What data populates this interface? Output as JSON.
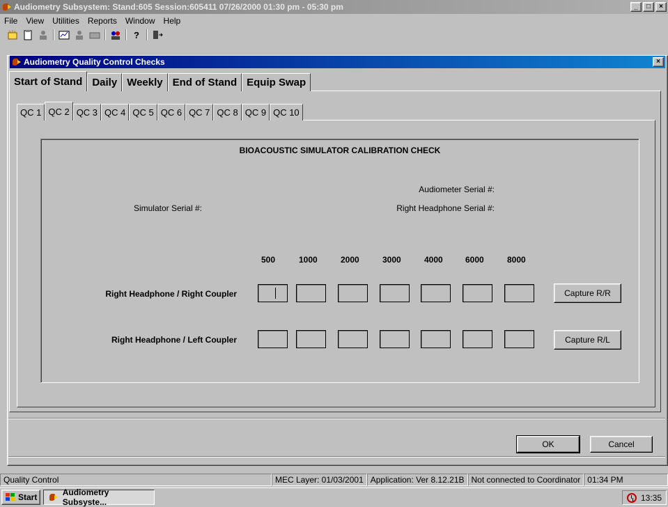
{
  "app": {
    "title": "Audiometry Subsystem: Stand:605 Session:605411 07/26/2000 01:30 pm - 05:30 pm",
    "window_buttons": [
      "_",
      "□",
      "×"
    ]
  },
  "menu": {
    "items": [
      {
        "label": "File"
      },
      {
        "label": "View"
      },
      {
        "label": "Utilities"
      },
      {
        "label": "Reports"
      },
      {
        "label": "Window"
      },
      {
        "label": "Help"
      }
    ]
  },
  "toolbar": {
    "icons": [
      "new-icon",
      "clipboard-icon",
      "person-icon",
      "chart-icon",
      "person2-icon",
      "keyboard-icon",
      "users-icon",
      "help-icon",
      "exit-icon"
    ]
  },
  "dialog": {
    "title": "Audiometry Quality Control Checks",
    "close_glyph": "×",
    "main_tabs": [
      "Start of Stand",
      "Daily",
      "Weekly",
      "End of Stand",
      "Equip Swap"
    ],
    "active_main_tab": "Start of Stand",
    "sub_tabs": [
      "QC 1",
      "QC 2",
      "QC 3",
      "QC 4",
      "QC 5",
      "QC 6",
      "QC 7",
      "QC 8",
      "QC 9",
      "QC 10"
    ],
    "active_sub_tab": "QC 2",
    "section_title": "BIOACOUSTIC SIMULATOR CALIBRATION CHECK",
    "audiometer_serial_label": "Audiometer Serial #:",
    "simulator_serial_label": "Simulator Serial #:",
    "right_headphone_serial_label": "Right Headphone Serial #:",
    "frequencies": [
      "500",
      "1000",
      "2000",
      "3000",
      "4000",
      "6000",
      "8000"
    ],
    "rows": [
      {
        "label": "Right Headphone / Right Coupler",
        "values": [
          "",
          "",
          "",
          "",
          "",
          "",
          ""
        ],
        "capture_label": "Capture R/R"
      },
      {
        "label": "Right Headphone / Left Coupler",
        "values": [
          "",
          "",
          "",
          "",
          "",
          "",
          ""
        ],
        "capture_label": "Capture R/L"
      }
    ],
    "ok_label": "OK",
    "cancel_label": "Cancel"
  },
  "status": {
    "mode": "Quality Control",
    "mec_layer": "MEC Layer: 01/03/2001",
    "application": "Application: Ver 8.12.21B",
    "coordinator": "Not connected to Coordinator",
    "time": "01:34 PM"
  },
  "taskbar": {
    "start_label": "Start",
    "task_label": "Audiometry Subsyste...",
    "clock": "13:35"
  },
  "colors": {
    "active_title": "#000080",
    "inactive_title": "#808080",
    "face": "#c0c0c0"
  }
}
